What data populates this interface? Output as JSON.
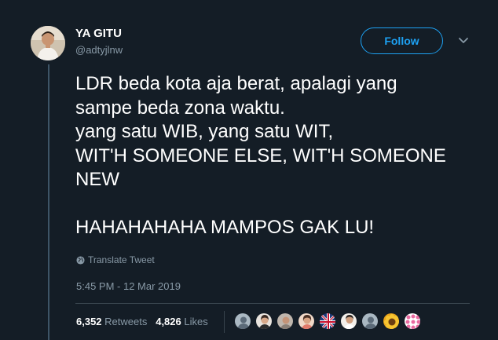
{
  "author": {
    "name": "YA GITU",
    "handle": "@adtyjlnw"
  },
  "follow_label": "Follow",
  "tweet": {
    "lines": [
      "LDR beda kota aja berat, apalagi yang",
      "sampe beda zona waktu.",
      "yang satu WIB, yang satu WIT,",
      "WIT'H SOMEONE ELSE, WIT'H SOMEONE",
      "NEW",
      "",
      "HAHAHAHAHA MAMPOS GAK LU!"
    ],
    "translate_label": "Translate Tweet",
    "timestamp": "5:45 PM - 12 Mar 2019"
  },
  "stats": {
    "retweets_count": "6,352",
    "retweets_label": "Retweets",
    "likes_count": "4,826",
    "likes_label": "Likes"
  },
  "liker_avatars": [
    "default-egg-avatar",
    "woman-photo-avatar",
    "person-photo-avatar",
    "person-photo-avatar",
    "flag-avatar",
    "person-photo-avatar",
    "default-egg-avatar",
    "sunflower-avatar",
    "pink-dots-avatar"
  ],
  "colors": {
    "background": "#141d26",
    "accent": "#1da1f2",
    "muted_text": "#8899a6",
    "thread_line": "#3d5466"
  }
}
